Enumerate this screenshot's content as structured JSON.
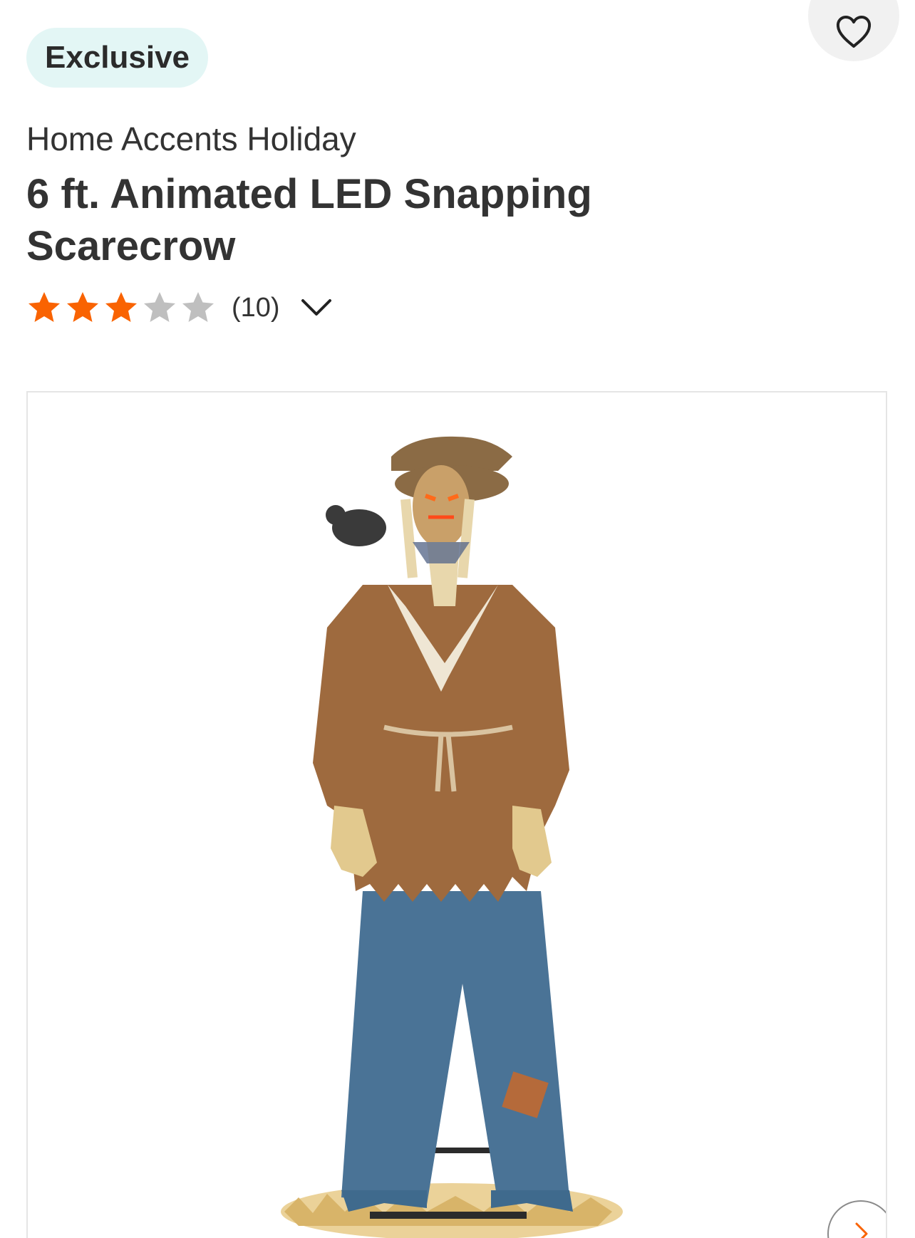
{
  "badge": {
    "label": "Exclusive"
  },
  "product": {
    "brand": "Home Accents Holiday",
    "title": "6 ft. Animated LED Snapping Scarecrow"
  },
  "rating": {
    "stars": 3,
    "max_stars": 5,
    "review_count": "(10)"
  },
  "gallery": {
    "image": "scarecrow-product-photo"
  },
  "icons": {
    "favorite": "heart-outline-icon",
    "expand": "chevron-down-icon",
    "next": "chevron-right-icon"
  },
  "colors": {
    "badge_bg": "#e3f6f5",
    "star_filled": "#f96302",
    "star_empty": "#bfbfbf",
    "next_arrow": "#f96302",
    "text": "#333333"
  }
}
